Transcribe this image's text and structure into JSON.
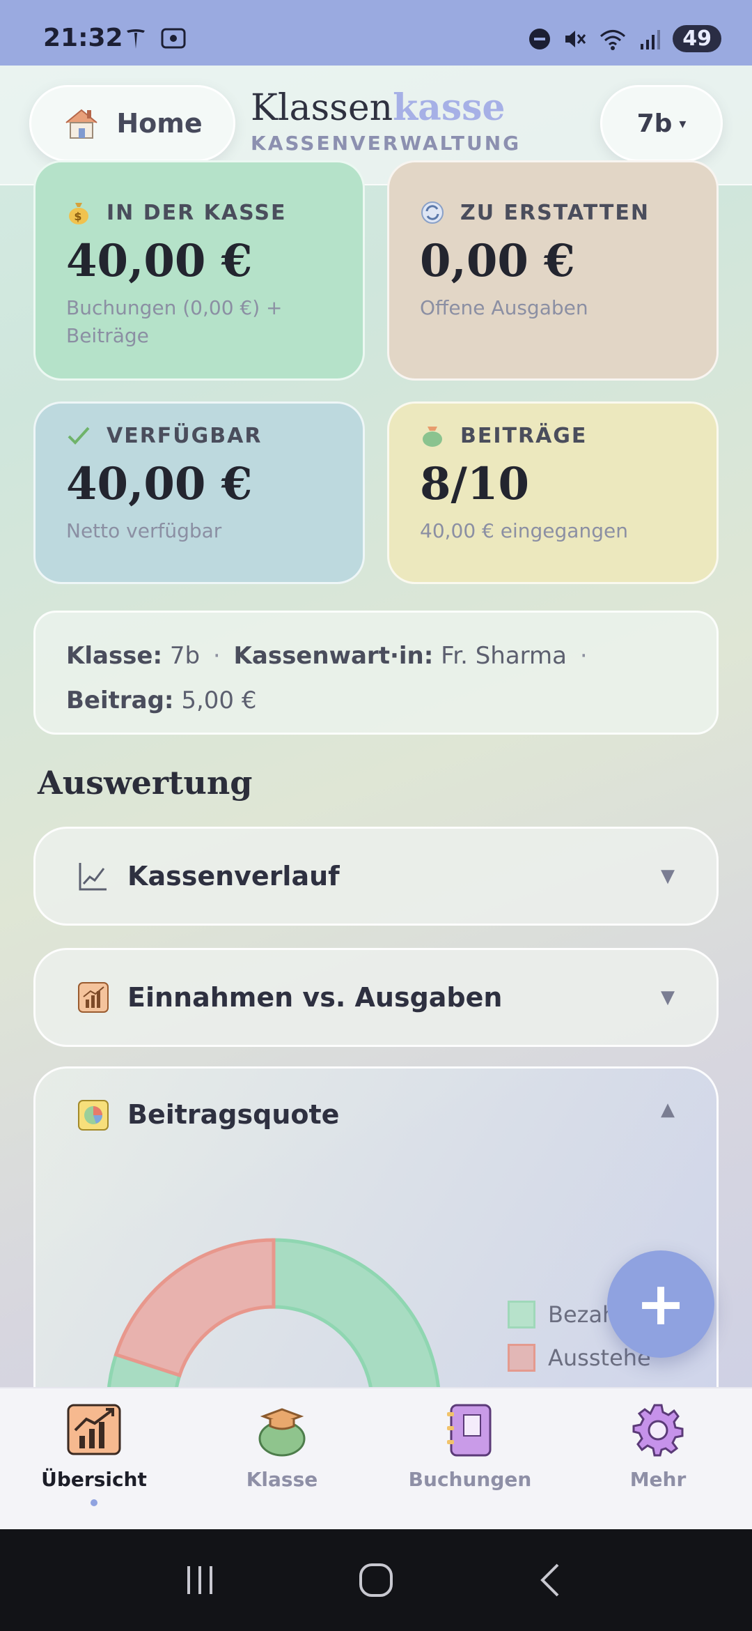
{
  "status_bar": {
    "time": "21:32",
    "battery": "49"
  },
  "header": {
    "home_label": "Home",
    "brand_part1": "Klassen",
    "brand_part2": "kasse",
    "brand_sub": "KASSENVERWALTUNG",
    "class_selector": "7b",
    "class_caret": "▾"
  },
  "cards": {
    "kasse": {
      "title": "IN DER KASSE",
      "value": "40,00 €",
      "note": "Buchungen (0,00 €) + Beiträge"
    },
    "erstatten": {
      "title": "ZU ERSTATTEN",
      "value": "0,00 €",
      "note": "Offene Ausgaben"
    },
    "verfuegbar": {
      "title": "VERFÜGBAR",
      "value": "40,00 €",
      "note": "Netto verfügbar"
    },
    "beitraege": {
      "title": "BEITRÄGE",
      "value": "8/10",
      "note": "40,00 € eingegangen"
    }
  },
  "info": {
    "klasse_label": "Klasse:",
    "klasse_value": "7b",
    "kassenwart_label": "Kassenwart·in:",
    "kassenwart_value": "Fr. Sharma",
    "beitrag_label": "Beitrag:",
    "beitrag_value": "5,00 €",
    "separator": "·"
  },
  "section_title": "Auswertung",
  "accordions": [
    {
      "label": "Kassenverlauf",
      "arrow": "▼"
    },
    {
      "label": "Einnahmen vs. Ausgaben",
      "arrow": "▼"
    },
    {
      "label": "Beitragsquote",
      "arrow": "▲"
    }
  ],
  "chart_data": {
    "type": "pie",
    "categories": [
      "Bezahlt",
      "Ausstehend"
    ],
    "values": [
      8,
      2
    ],
    "colors": [
      "#a8dcc2",
      "#e8b2ae"
    ],
    "legend_placement": "right"
  },
  "legend_visible": [
    "Bezah",
    "Ausstehe"
  ],
  "fab_label": "+",
  "bottom_nav": [
    {
      "label": "Übersicht",
      "icon": "chart-board-icon",
      "active": true
    },
    {
      "label": "Klasse",
      "icon": "graduation-bag-icon",
      "active": false
    },
    {
      "label": "Buchungen",
      "icon": "notebook-icon",
      "active": false
    },
    {
      "label": "Mehr",
      "icon": "gear-icon",
      "active": false
    }
  ]
}
